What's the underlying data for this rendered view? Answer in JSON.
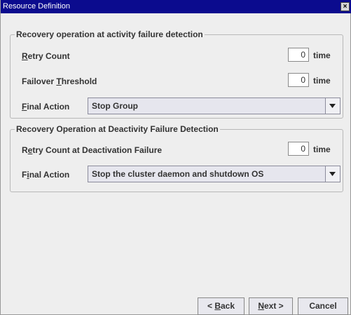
{
  "window": {
    "title": "Resource Definition",
    "close_glyph": "×"
  },
  "activity_group": {
    "legend": "Recovery operation at activity failure detection",
    "retry_count": {
      "mnemonic": "R",
      "rest": "etry Count",
      "value": "0",
      "unit": "time"
    },
    "failover_threshold": {
      "pre": "Failover ",
      "mnemonic": "T",
      "rest": "hreshold",
      "value": "0",
      "unit": "time"
    },
    "final_action": {
      "mnemonic": "F",
      "rest": "inal Action",
      "selected": "Stop Group"
    }
  },
  "deactivity_group": {
    "legend": "Recovery Operation at Deactivity Failure Detection",
    "retry_count": {
      "pre": "R",
      "mnemonic": "e",
      "rest": "try Count at Deactivation Failure",
      "value": "0",
      "unit": "time"
    },
    "final_action": {
      "pre": "F",
      "mnemonic": "i",
      "rest": "nal Action",
      "selected": "Stop the cluster daemon and shutdown OS"
    }
  },
  "buttons": {
    "back": {
      "pre": "< ",
      "mnemonic": "B",
      "rest": "ack"
    },
    "next": {
      "pre": "",
      "mnemonic": "N",
      "rest": "ext >"
    },
    "cancel": {
      "label": "Cancel"
    }
  },
  "icons": {
    "close": "close-icon",
    "dropdown": "triangle-down-icon"
  },
  "colors": {
    "titlebar": "#0b0b8e",
    "window_bg": "#eeeeee",
    "combo_bg": "#e6e6ee"
  }
}
